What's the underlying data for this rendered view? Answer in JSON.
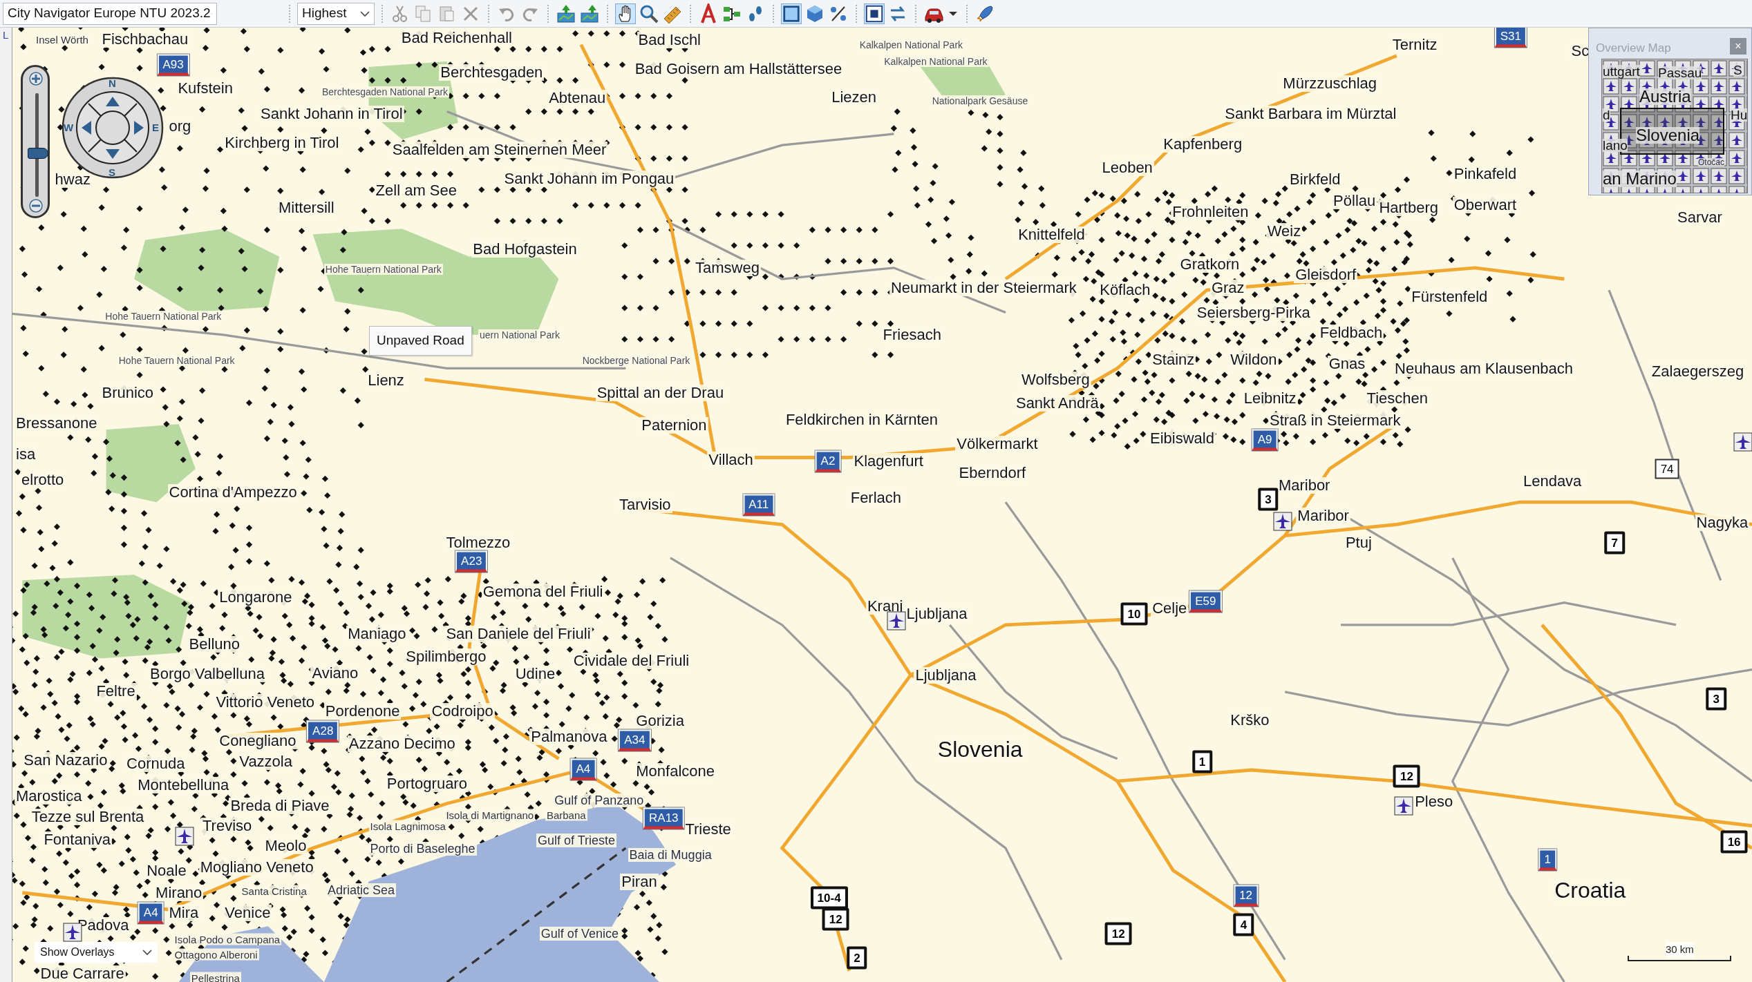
{
  "toolbar": {
    "map_product": "City Navigator Europe NTU 2023.2",
    "detail": "Highest"
  },
  "side_panel": {
    "label": "L"
  },
  "map": {
    "labels": [
      {
        "text": "Insel Wörth",
        "kind": "small"
      },
      {
        "text": "Fischbachau",
        "kind": "city"
      },
      {
        "text": "Kufstein",
        "kind": "city"
      },
      {
        "text": "org",
        "kind": "city"
      },
      {
        "text": "Sankt Johann in Tirol",
        "kind": "city"
      },
      {
        "text": "Kirchberg in Tirol",
        "kind": "city"
      },
      {
        "text": "hwaz",
        "kind": "city"
      },
      {
        "text": "Berchtesgaden National Park",
        "kind": "park"
      },
      {
        "text": "Bad Reichenhall",
        "kind": "city"
      },
      {
        "text": "Berchtesgaden",
        "kind": "city"
      },
      {
        "text": "Bad Ischl",
        "kind": "city"
      },
      {
        "text": "Kalkalpen National Park",
        "kind": "park"
      },
      {
        "text": "Kalkalpen National Park",
        "kind": "park"
      },
      {
        "text": "Bad Goisern am Hallstättersee",
        "kind": "city"
      },
      {
        "text": "Abtenau",
        "kind": "city"
      },
      {
        "text": "Liezen",
        "kind": "city"
      },
      {
        "text": "Nationalpark Gesäuse",
        "kind": "park"
      },
      {
        "text": "Saalfelden am Steinernen Meer",
        "kind": "city"
      },
      {
        "text": "Sankt Johann im Pongau",
        "kind": "city"
      },
      {
        "text": "Zell am See",
        "kind": "city"
      },
      {
        "text": "Mittersill",
        "kind": "city"
      },
      {
        "text": "Bad Hofgastein",
        "kind": "city"
      },
      {
        "text": "Hohe Tauern National Park",
        "kind": "park"
      },
      {
        "text": "Tamsweg",
        "kind": "city"
      },
      {
        "text": "Hohe Tauern National Park",
        "kind": "park"
      },
      {
        "text": "uern National Park",
        "kind": "park"
      },
      {
        "text": "Hohe Tauern National Park",
        "kind": "park"
      },
      {
        "text": "Nockberge National Park",
        "kind": "park"
      },
      {
        "text": "Brunico",
        "kind": "city"
      },
      {
        "text": "Lienz",
        "kind": "city"
      },
      {
        "text": "Spittal an der Drau",
        "kind": "city"
      },
      {
        "text": "Bressanone",
        "kind": "city"
      },
      {
        "text": "Paternion",
        "kind": "city"
      },
      {
        "text": "isa",
        "kind": "city"
      },
      {
        "text": "elrotto",
        "kind": "city"
      },
      {
        "text": "Cortina d'Ampezzo",
        "kind": "city"
      },
      {
        "text": "Villach",
        "kind": "city"
      },
      {
        "text": "Feldkirchen in Kärnten",
        "kind": "city"
      },
      {
        "text": "Klagenfurt",
        "kind": "city"
      },
      {
        "text": "Völkermarkt",
        "kind": "city"
      },
      {
        "text": "Eberndorf",
        "kind": "city"
      },
      {
        "text": "Tarvisio",
        "kind": "city"
      },
      {
        "text": "Ferlach",
        "kind": "city"
      },
      {
        "text": "Tolmezzo",
        "kind": "city"
      },
      {
        "text": "Gemona del Friuli",
        "kind": "city"
      },
      {
        "text": "Longarone",
        "kind": "city"
      },
      {
        "text": "Belluno",
        "kind": "city"
      },
      {
        "text": "Maniago",
        "kind": "city"
      },
      {
        "text": "San Daniele del Friuli",
        "kind": "city"
      },
      {
        "text": "Spilimbergo",
        "kind": "city"
      },
      {
        "text": "Borgo Valbelluna",
        "kind": "city"
      },
      {
        "text": "Aviano",
        "kind": "city"
      },
      {
        "text": "Udine",
        "kind": "city"
      },
      {
        "text": "Cividale del Friuli",
        "kind": "city"
      },
      {
        "text": "Feltre",
        "kind": "city"
      },
      {
        "text": "Vittorio Veneto",
        "kind": "city"
      },
      {
        "text": "Pordenone",
        "kind": "city"
      },
      {
        "text": "Codroipo",
        "kind": "city"
      },
      {
        "text": "Gorizia",
        "kind": "city"
      },
      {
        "text": "Conegliano",
        "kind": "city"
      },
      {
        "text": "Azzano Decimo",
        "kind": "city"
      },
      {
        "text": "Palmanova",
        "kind": "city"
      },
      {
        "text": "San Nazario",
        "kind": "city"
      },
      {
        "text": "Cornuda",
        "kind": "city"
      },
      {
        "text": "Vazzola",
        "kind": "city"
      },
      {
        "text": "Monfalcone",
        "kind": "city"
      },
      {
        "text": "Montebelluna",
        "kind": "city"
      },
      {
        "text": "Portogruaro",
        "kind": "city"
      },
      {
        "text": "Marostica",
        "kind": "city"
      },
      {
        "text": "Breda di Piave",
        "kind": "city"
      },
      {
        "text": "Gulf of Panzano",
        "kind": "water"
      },
      {
        "text": "Tezze sul Brenta",
        "kind": "city"
      },
      {
        "text": "Fontaniva",
        "kind": "city"
      },
      {
        "text": "Treviso",
        "kind": "city"
      },
      {
        "text": "Meolo",
        "kind": "city"
      },
      {
        "text": "Porto di Baseleghe",
        "kind": "water"
      },
      {
        "text": "Trieste",
        "kind": "city"
      },
      {
        "text": "Gulf of Trieste",
        "kind": "water"
      },
      {
        "text": "Baia di Muggia",
        "kind": "water"
      },
      {
        "text": "Noale",
        "kind": "city"
      },
      {
        "text": "Mogliano Veneto",
        "kind": "city"
      },
      {
        "text": "Mirano",
        "kind": "city"
      },
      {
        "text": "Santa Cristina",
        "kind": "small"
      },
      {
        "text": "Adriatic Sea",
        "kind": "water"
      },
      {
        "text": "Piran",
        "kind": "city"
      },
      {
        "text": "Padova",
        "kind": "city"
      },
      {
        "text": "Mira",
        "kind": "city"
      },
      {
        "text": "Venice",
        "kind": "city"
      },
      {
        "text": "Gulf of Venice",
        "kind": "water"
      },
      {
        "text": "Isola Podo o Campana",
        "kind": "small"
      },
      {
        "text": "Ottagono Alberoni",
        "kind": "small"
      },
      {
        "text": "Due Carrare",
        "kind": "city"
      },
      {
        "text": "Pellestrina",
        "kind": "small"
      },
      {
        "text": "Isola Lagnimosa",
        "kind": "small"
      },
      {
        "text": "Isola di Martignano",
        "kind": "small"
      },
      {
        "text": "Barbana",
        "kind": "small"
      },
      {
        "text": "Ternitz",
        "kind": "city"
      },
      {
        "text": "Sc",
        "kind": "city"
      },
      {
        "text": "Mürzzuschlag",
        "kind": "city"
      },
      {
        "text": "Sankt Barbara im Mürztal",
        "kind": "city"
      },
      {
        "text": "Kapfenberg",
        "kind": "city"
      },
      {
        "text": "Leoben",
        "kind": "city"
      },
      {
        "text": "Birkfeld",
        "kind": "city"
      },
      {
        "text": "Pinkafeld",
        "kind": "city"
      },
      {
        "text": "Frohnleiten",
        "kind": "city"
      },
      {
        "text": "Pöllau",
        "kind": "city"
      },
      {
        "text": "Hartberg",
        "kind": "city"
      },
      {
        "text": "Oberwart",
        "kind": "city"
      },
      {
        "text": "Sarvar",
        "kind": "city"
      },
      {
        "text": "Knittelfeld",
        "kind": "city"
      },
      {
        "text": "Weiz",
        "kind": "city"
      },
      {
        "text": "Gratkorn",
        "kind": "city"
      },
      {
        "text": "Gleisdorf",
        "kind": "city"
      },
      {
        "text": "Neumarkt in der Steiermark",
        "kind": "city"
      },
      {
        "text": "Köflach",
        "kind": "city"
      },
      {
        "text": "Graz",
        "kind": "city"
      },
      {
        "text": "Fürstenfeld",
        "kind": "city"
      },
      {
        "text": "Seiersberg-Pirka",
        "kind": "city"
      },
      {
        "text": "Friesach",
        "kind": "city"
      },
      {
        "text": "Feldbach",
        "kind": "city"
      },
      {
        "text": "Stainz",
        "kind": "city"
      },
      {
        "text": "Wildon",
        "kind": "city"
      },
      {
        "text": "Gnas",
        "kind": "city"
      },
      {
        "text": "Wolfsberg",
        "kind": "city"
      },
      {
        "text": "Neuhaus am Klausenbach",
        "kind": "city"
      },
      {
        "text": "Zalaegerszeg",
        "kind": "city"
      },
      {
        "text": "Sankt Andrä",
        "kind": "city"
      },
      {
        "text": "Leibnitz",
        "kind": "city"
      },
      {
        "text": "Tieschen",
        "kind": "city"
      },
      {
        "text": "Straß in Steiermark",
        "kind": "city"
      },
      {
        "text": "Eibiswald",
        "kind": "city"
      },
      {
        "text": "Maribor",
        "kind": "city"
      },
      {
        "text": "Lendava",
        "kind": "city"
      },
      {
        "text": "Maribor",
        "kind": "city"
      },
      {
        "text": "Nagyka",
        "kind": "city"
      },
      {
        "text": "Ptuj",
        "kind": "city"
      },
      {
        "text": "Kranj",
        "kind": "city"
      },
      {
        "text": "Ljubljana",
        "kind": "city"
      },
      {
        "text": "Celje",
        "kind": "city"
      },
      {
        "text": "Ljubljana",
        "kind": "city"
      },
      {
        "text": "Krško",
        "kind": "city"
      },
      {
        "text": "Slovenia",
        "kind": "country"
      },
      {
        "text": "Pleso",
        "kind": "city"
      },
      {
        "text": "Croatia",
        "kind": "country"
      }
    ],
    "shields": [
      {
        "text": "A93",
        "kind": "motorway"
      },
      {
        "text": "S31",
        "kind": "motorway"
      },
      {
        "text": "A2",
        "kind": "motorway"
      },
      {
        "text": "A11",
        "kind": "motorway"
      },
      {
        "text": "A9",
        "kind": "motorway"
      },
      {
        "text": "A23",
        "kind": "motorway"
      },
      {
        "text": "E59",
        "kind": "motorway"
      },
      {
        "text": "A28",
        "kind": "motorway"
      },
      {
        "text": "A34",
        "kind": "motorway"
      },
      {
        "text": "A4",
        "kind": "motorway"
      },
      {
        "text": "RA13",
        "kind": "motorway"
      },
      {
        "text": "A4",
        "kind": "motorway"
      },
      {
        "text": "1",
        "kind": "motorway"
      },
      {
        "text": "12",
        "kind": "motorway"
      },
      {
        "text": "3",
        "kind": "route"
      },
      {
        "text": "7",
        "kind": "route"
      },
      {
        "text": "10",
        "kind": "route"
      },
      {
        "text": "1",
        "kind": "route"
      },
      {
        "text": "12",
        "kind": "route"
      },
      {
        "text": "10-4",
        "kind": "route"
      },
      {
        "text": "12",
        "kind": "route"
      },
      {
        "text": "12",
        "kind": "route"
      },
      {
        "text": "4",
        "kind": "route"
      },
      {
        "text": "2",
        "kind": "route"
      },
      {
        "text": "3",
        "kind": "route"
      },
      {
        "text": "16",
        "kind": "route"
      },
      {
        "text": "74",
        "kind": "local"
      }
    ],
    "tooltip": "Unpaved Road",
    "overlay_select": "Show Overlays",
    "scale": "30 km"
  },
  "zoom_slider": {
    "level": 0.42
  },
  "compass": {
    "north": "N",
    "east": "E",
    "south": "S",
    "west": "W"
  },
  "overview_map": {
    "title": "Overview Map",
    "close": "×",
    "labels": [
      {
        "text": "uttgart",
        "kind": "city"
      },
      {
        "text": "Passau",
        "kind": "city"
      },
      {
        "text": "S",
        "kind": "city"
      },
      {
        "text": "Austria",
        "kind": "country"
      },
      {
        "text": "d",
        "kind": "city"
      },
      {
        "text": "Hu",
        "kind": "city"
      },
      {
        "text": "Slovenia",
        "kind": "country"
      },
      {
        "text": "lano",
        "kind": "city"
      },
      {
        "text": "an Marino",
        "kind": "country"
      },
      {
        "text": "Otočac",
        "kind": "small"
      }
    ]
  }
}
